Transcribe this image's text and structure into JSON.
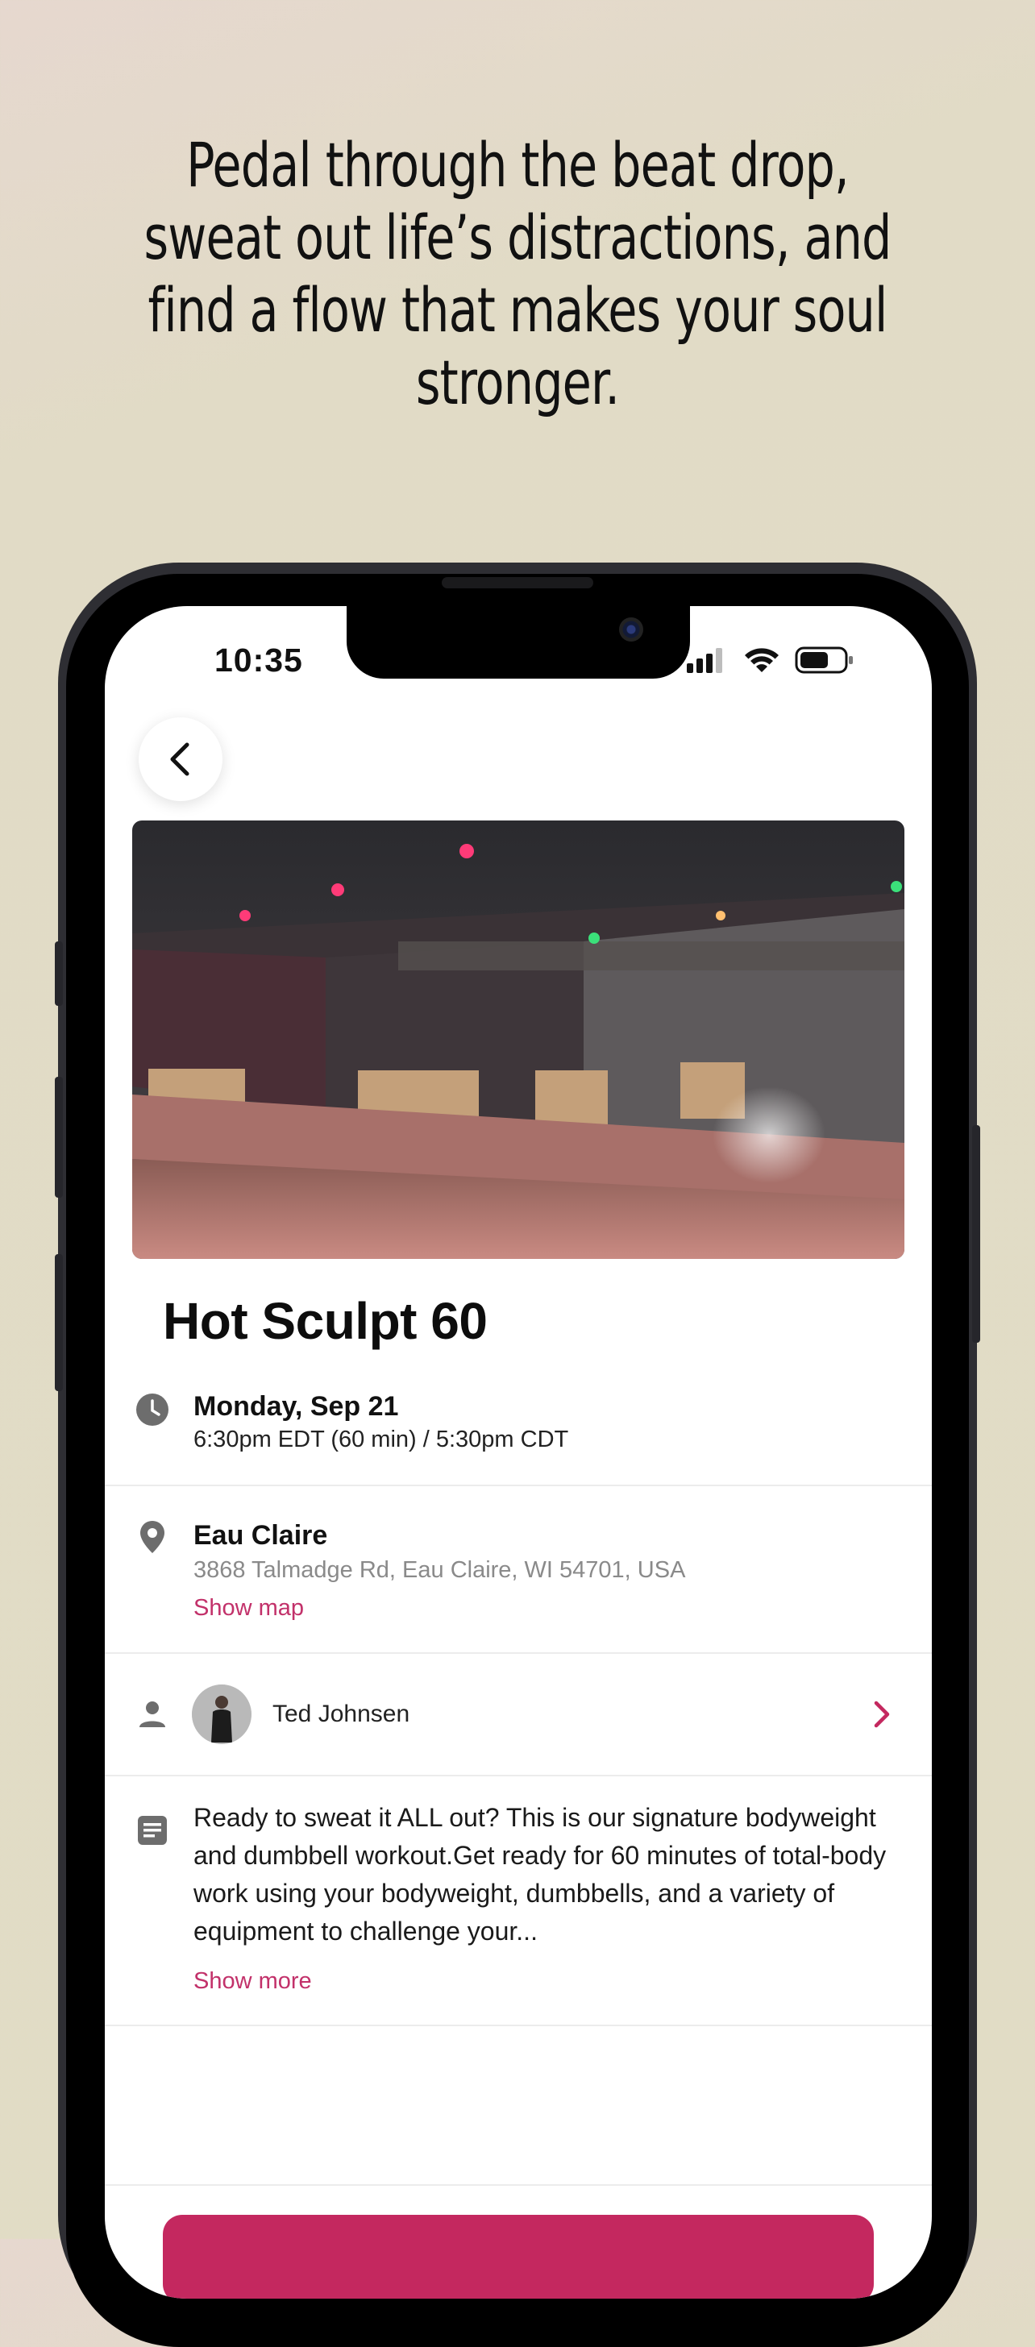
{
  "promo": {
    "headline": "Pedal through the beat drop, sweat out life’s distractions, and find a flow that makes your soul stronger."
  },
  "status_bar": {
    "time": "10:35"
  },
  "class": {
    "title": "Hot Sculpt 60",
    "date": "Monday, Sep 21",
    "time_range": "6:30pm EDT (60 min) / 5:30pm CDT",
    "location_name": "Eau Claire",
    "address": "3868 Talmadge Rd, Eau Claire, WI 54701, USA",
    "show_map": "Show map",
    "instructor": "Ted Johnsen",
    "description": "Ready to sweat it ALL out? This is our signature bodyweight and dumbbell workout.Get ready for 60 minutes of total-body work using your bodyweight, dumbbells, and a variety of equipment to challenge your...",
    "show_more": "Show more"
  },
  "colors": {
    "accent": "#c4285f",
    "background": "#e1dcc5"
  }
}
